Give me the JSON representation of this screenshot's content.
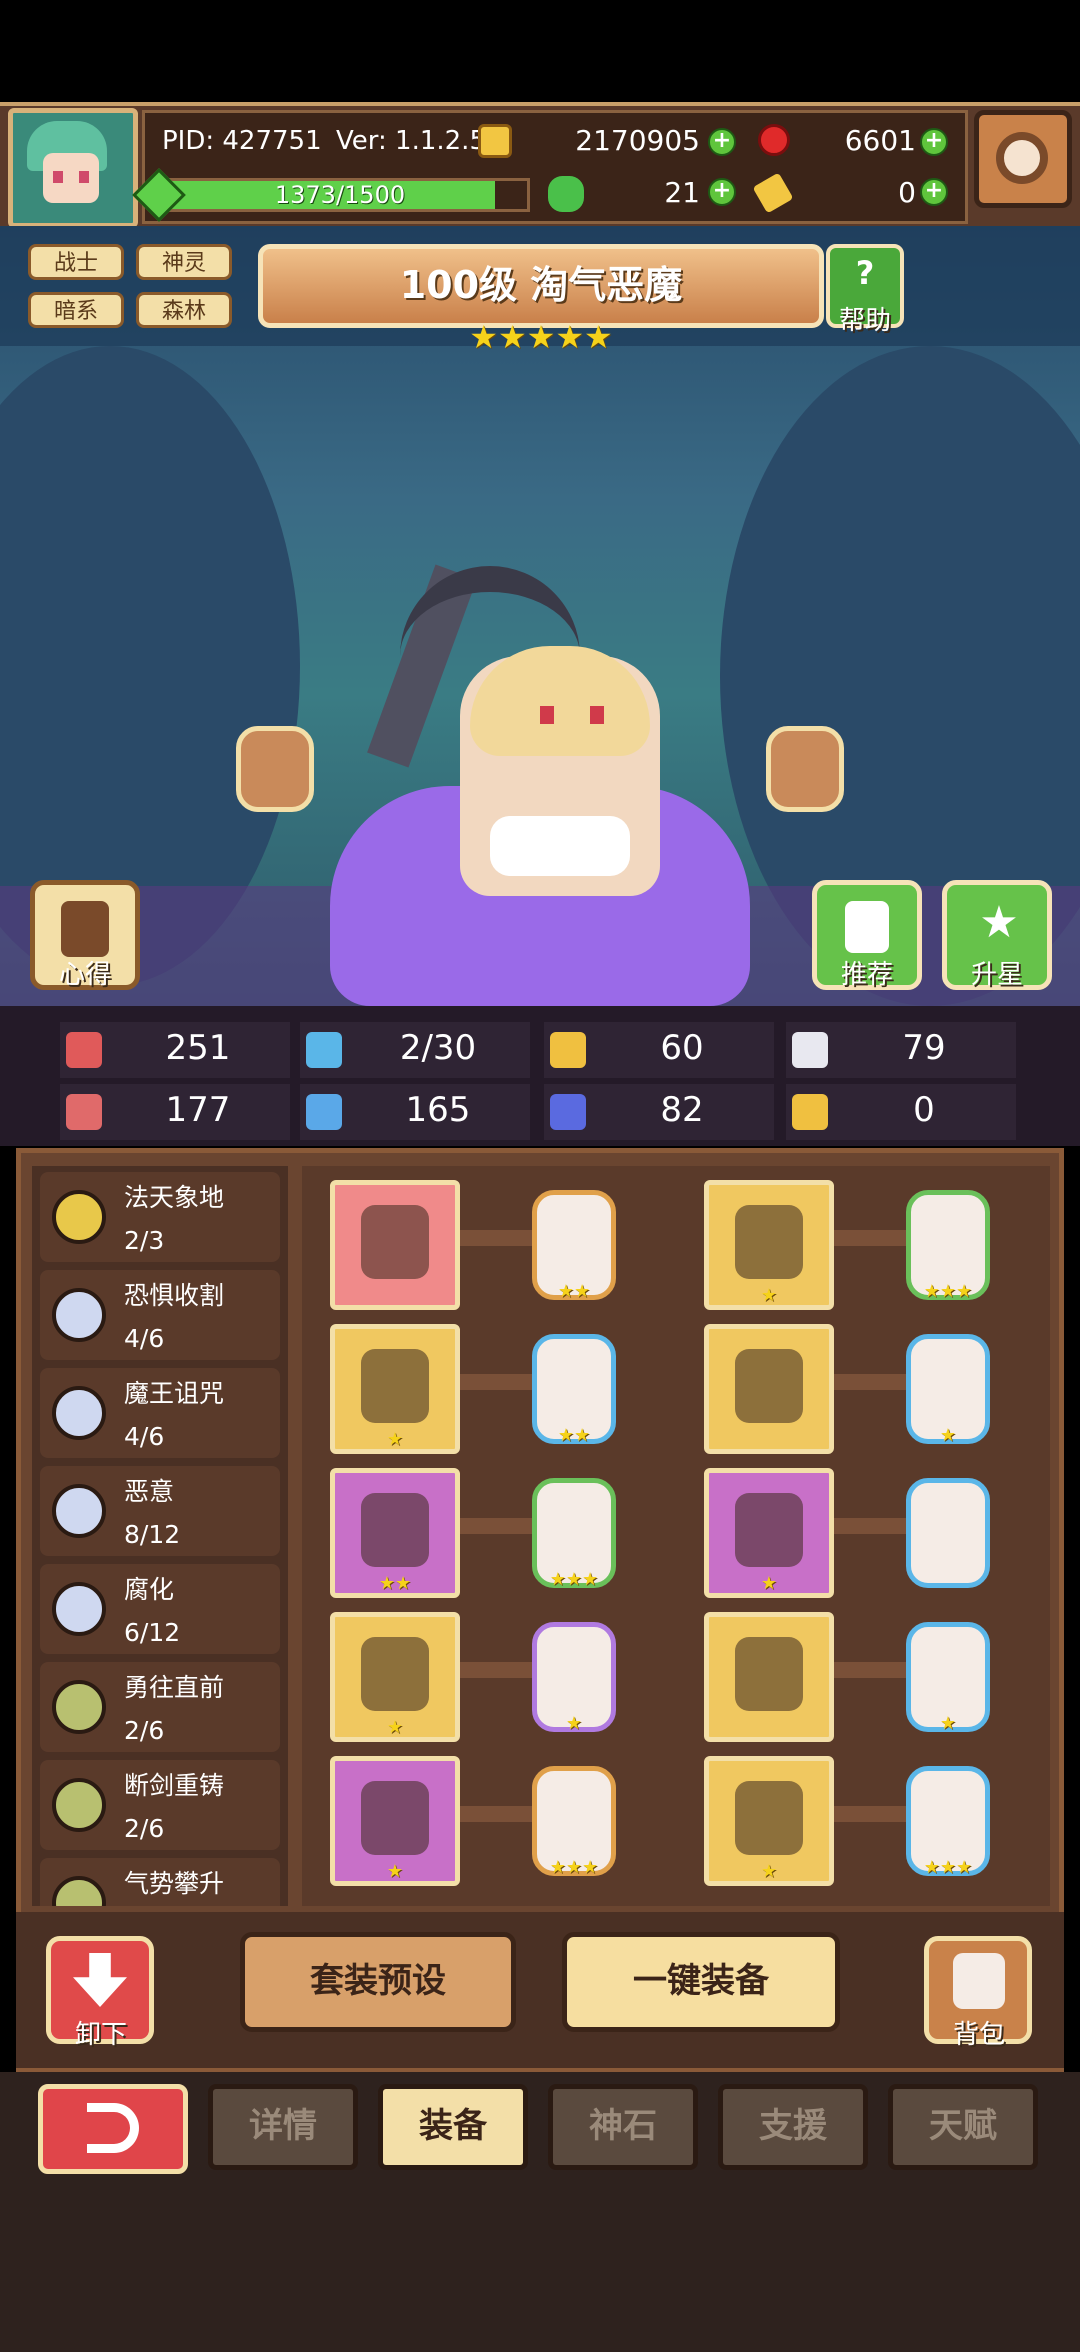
{
  "hud": {
    "pid": "PID: 427751",
    "version": "Ver: 1.1.2.5",
    "gold": "2170905",
    "gems": "6601",
    "xp": "1373/1500",
    "xp_fraction": 0.915,
    "clovers": "21",
    "keys": "0"
  },
  "character": {
    "tags": [
      "战士",
      "神灵",
      "暗系",
      "森林"
    ],
    "title": "100级 淘气恶魔",
    "stars": "★★★★★",
    "help_label": "帮助",
    "left_btn_label": "心得",
    "recommend_label": "推荐",
    "starup_label": "升星"
  },
  "stats": [
    {
      "icon": "heart-icon",
      "value": "251",
      "color": "#e05a5a"
    },
    {
      "icon": "drop-icon",
      "value": "2/30",
      "color": "#5ab6e8"
    },
    {
      "icon": "shield-icon",
      "value": "60",
      "color": "#f0c040"
    },
    {
      "icon": "wing-icon",
      "value": "79",
      "color": "#e8e8f0"
    },
    {
      "icon": "fist-icon",
      "value": "177",
      "color": "#e06a6a"
    },
    {
      "icon": "book-icon",
      "value": "165",
      "color": "#5aa8e8"
    },
    {
      "icon": "boot-icon",
      "value": "82",
      "color": "#5a6ae0"
    },
    {
      "icon": "horseshoe-icon",
      "value": "0",
      "color": "#f0c040"
    }
  ],
  "sets": [
    {
      "name": "法天象地",
      "count": "2/3",
      "color": "#e8c84a"
    },
    {
      "name": "恐惧收割",
      "count": "4/6",
      "color": "#cfd8f0"
    },
    {
      "name": "魔王诅咒",
      "count": "4/6",
      "color": "#cfd8f0"
    },
    {
      "name": "恶意",
      "count": "8/12",
      "color": "#cfd8f0"
    },
    {
      "name": "腐化",
      "count": "6/12",
      "color": "#cfd8f0"
    },
    {
      "name": "勇往直前",
      "count": "2/6",
      "color": "#b8c070"
    },
    {
      "name": "断剑重铸",
      "count": "2/6",
      "color": "#b8c070"
    },
    {
      "name": "气势攀升",
      "count": "",
      "color": "#b8c070"
    }
  ],
  "equipment": [
    {
      "item_icon": "staff-icon",
      "item_bg": "#f08a8a",
      "item_stars": "",
      "rune_stars": "★★",
      "rune_border": "#e0a04a"
    },
    {
      "item_icon": "helmet-icon",
      "item_bg": "#f0c860",
      "item_stars": "★",
      "rune_stars": "★★★",
      "rune_border": "#6ac05a"
    },
    {
      "item_icon": "armor-icon",
      "item_bg": "#f0c860",
      "item_stars": "★",
      "rune_stars": "★★",
      "rune_border": "#5ab6e8"
    },
    {
      "item_icon": "chest-icon",
      "item_bg": "#f0c860",
      "item_stars": "",
      "rune_stars": "★",
      "rune_border": "#5ab6e8"
    },
    {
      "item_icon": "necklace-icon",
      "item_bg": "#c870c8",
      "item_stars": "★★",
      "rune_stars": "★★★",
      "rune_border": "#6ac05a"
    },
    {
      "item_icon": "glove-icon",
      "item_bg": "#c870c8",
      "item_stars": "★",
      "rune_stars": "",
      "rune_border": "#5ab6e8"
    },
    {
      "item_icon": "ore-icon",
      "item_bg": "#f0c860",
      "item_stars": "★",
      "rune_stars": "★",
      "rune_border": "#b07ae0"
    },
    {
      "item_icon": "bowl-icon",
      "item_bg": "#f0c860",
      "item_stars": "",
      "rune_stars": "★",
      "rune_border": "#5ab6e8"
    },
    {
      "item_icon": "ring-icon",
      "item_bg": "#c870c8",
      "item_stars": "★",
      "rune_stars": "★★★",
      "rune_border": "#e0a04a"
    },
    {
      "item_icon": "boots-icon",
      "item_bg": "#f0c860",
      "item_stars": "★",
      "rune_stars": "★★★",
      "rune_border": "#5ab6e8"
    }
  ],
  "actions": {
    "unequip_label": "卸下",
    "preset_label": "套装预设",
    "auto_equip_label": "一键装备",
    "bag_label": "背包"
  },
  "nav": {
    "tabs": [
      "详情",
      "装备",
      "神石",
      "支援",
      "天赋"
    ],
    "active": "装备"
  }
}
